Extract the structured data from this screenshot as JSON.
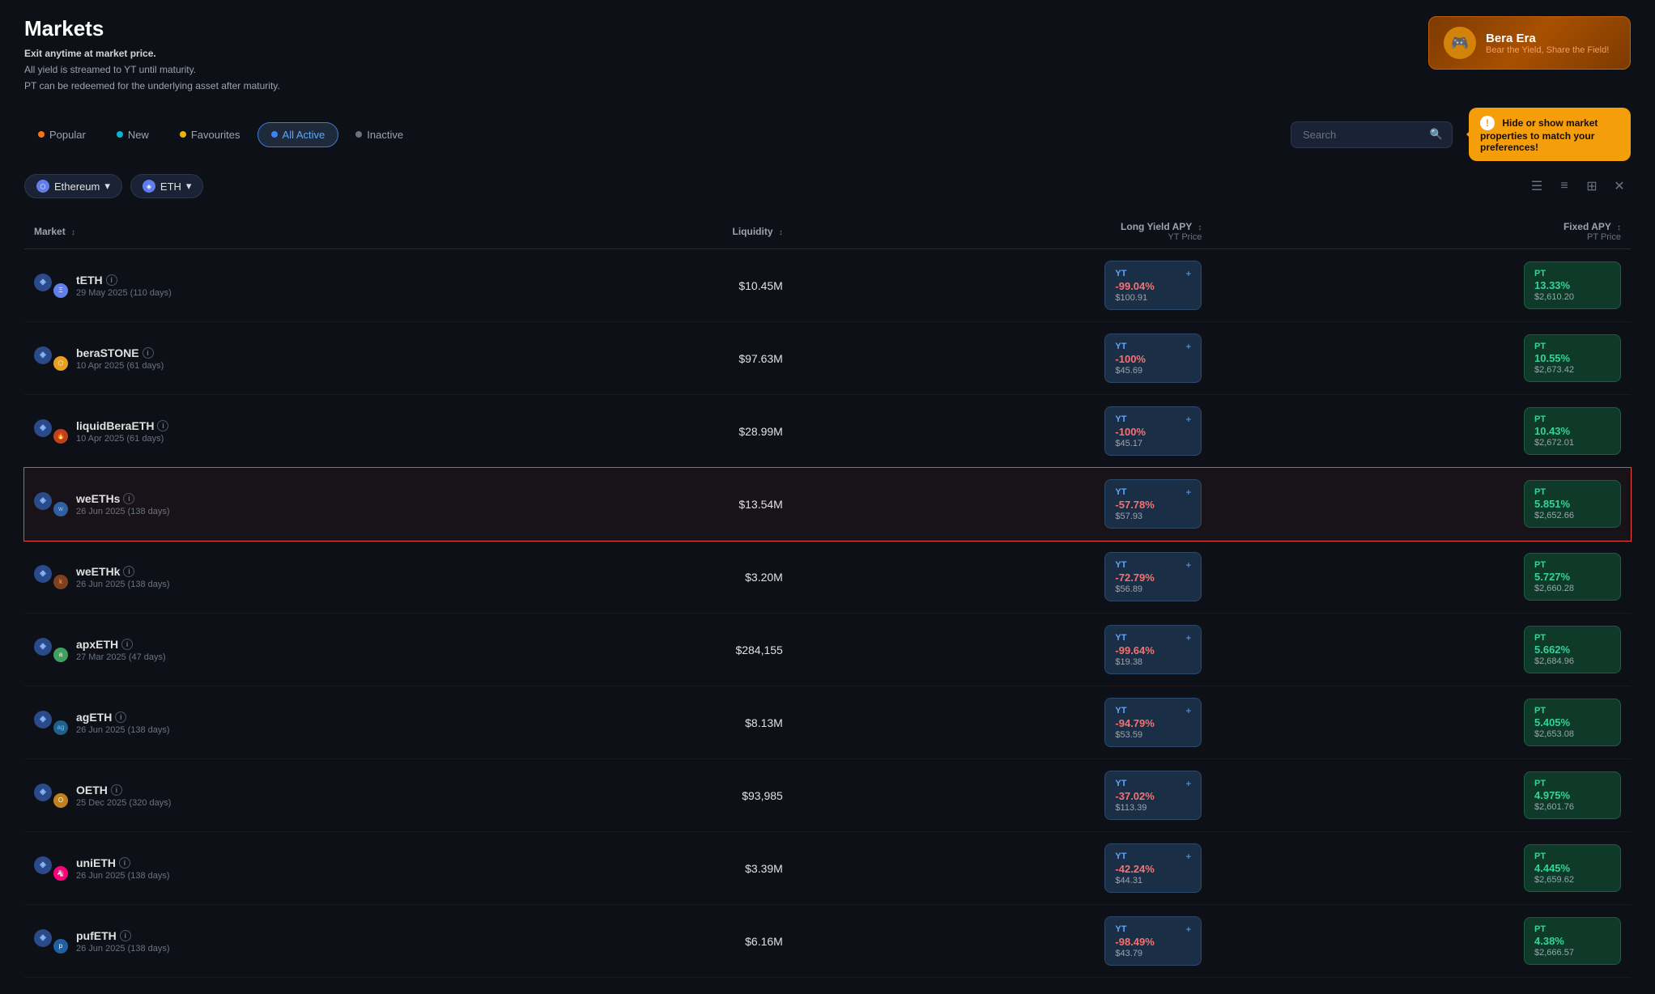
{
  "page": {
    "title": "Markets",
    "subtitle1": "Exit anytime at market price.",
    "subtitle2": "All yield is streamed to YT until maturity.",
    "subtitle3": "PT can be redeemed for the underlying asset after maturity."
  },
  "banner": {
    "title": "Bera Era",
    "subtitle": "Bear the Yield, Share the Field!"
  },
  "tabs": [
    {
      "id": "popular",
      "label": "Popular",
      "dot": "orange",
      "active": false
    },
    {
      "id": "new",
      "label": "New",
      "dot": "cyan",
      "active": false
    },
    {
      "id": "favourites",
      "label": "Favourites",
      "dot": "yellow",
      "active": false
    },
    {
      "id": "all-active",
      "label": "All Active",
      "dot": "blue",
      "active": true
    },
    {
      "id": "inactive",
      "label": "Inactive",
      "dot": "gray",
      "active": false
    }
  ],
  "search": {
    "placeholder": "Search"
  },
  "tooltip": {
    "text": "Hide or show market properties to match your preferences!"
  },
  "filters": {
    "chain": "Ethereum",
    "asset": "ETH"
  },
  "table": {
    "columns": {
      "market": "Market",
      "liquidity": "Liquidity",
      "long_yield": "Long Yield APY",
      "long_yield_sub": "YT Price",
      "fixed_apy": "Fixed APY",
      "fixed_apy_sub": "PT Price"
    },
    "rows": [
      {
        "name": "tETH",
        "date": "29 May 2025 (110 days)",
        "liquidity": "$10.45M",
        "yt_pct": "-99.04%",
        "yt_price": "$100.91",
        "pt_pct": "13.33%",
        "pt_price": "$2,610.20",
        "selected": false
      },
      {
        "name": "beraSTONE",
        "date": "10 Apr 2025 (61 days)",
        "liquidity": "$97.63M",
        "yt_pct": "-100%",
        "yt_price": "$45.69",
        "pt_pct": "10.55%",
        "pt_price": "$2,673.42",
        "selected": false
      },
      {
        "name": "liquidBeraETH",
        "date": "10 Apr 2025 (61 days)",
        "liquidity": "$28.99M",
        "yt_pct": "-100%",
        "yt_price": "$45.17",
        "pt_pct": "10.43%",
        "pt_price": "$2,672.01",
        "selected": false
      },
      {
        "name": "weETHs",
        "date": "26 Jun 2025 (138 days)",
        "liquidity": "$13.54M",
        "yt_pct": "-57.78%",
        "yt_price": "$57.93",
        "pt_pct": "5.851%",
        "pt_price": "$2,652.66",
        "selected": true
      },
      {
        "name": "weETHk",
        "date": "26 Jun 2025 (138 days)",
        "liquidity": "$3.20M",
        "yt_pct": "-72.79%",
        "yt_price": "$56.89",
        "pt_pct": "5.727%",
        "pt_price": "$2,660.28",
        "selected": false
      },
      {
        "name": "apxETH",
        "date": "27 Mar 2025 (47 days)",
        "liquidity": "$284,155",
        "yt_pct": "-99.64%",
        "yt_price": "$19.38",
        "pt_pct": "5.662%",
        "pt_price": "$2,684.96",
        "selected": false
      },
      {
        "name": "agETH",
        "date": "26 Jun 2025 (138 days)",
        "liquidity": "$8.13M",
        "yt_pct": "-94.79%",
        "yt_price": "$53.59",
        "pt_pct": "5.405%",
        "pt_price": "$2,653.08",
        "selected": false
      },
      {
        "name": "OETH",
        "date": "25 Dec 2025 (320 days)",
        "liquidity": "$93,985",
        "yt_pct": "-37.02%",
        "yt_price": "$113.39",
        "pt_pct": "4.975%",
        "pt_price": "$2,601.76",
        "selected": false
      },
      {
        "name": "uniETH",
        "date": "26 Jun 2025 (138 days)",
        "liquidity": "$3.39M",
        "yt_pct": "-42.24%",
        "yt_price": "$44.31",
        "pt_pct": "4.445%",
        "pt_price": "$2,659.62",
        "selected": false
      },
      {
        "name": "pufETH",
        "date": "26 Jun 2025 (138 days)",
        "liquidity": "$6.16M",
        "yt_pct": "-98.49%",
        "yt_price": "$43.79",
        "pt_pct": "4.38%",
        "pt_price": "$2,666.57",
        "selected": false
      }
    ]
  },
  "icons": {
    "search": "🔍",
    "list": "☰",
    "grid": "⊞",
    "tiles": "▦",
    "close": "✕",
    "info": "i",
    "chevron_down": "▾"
  }
}
